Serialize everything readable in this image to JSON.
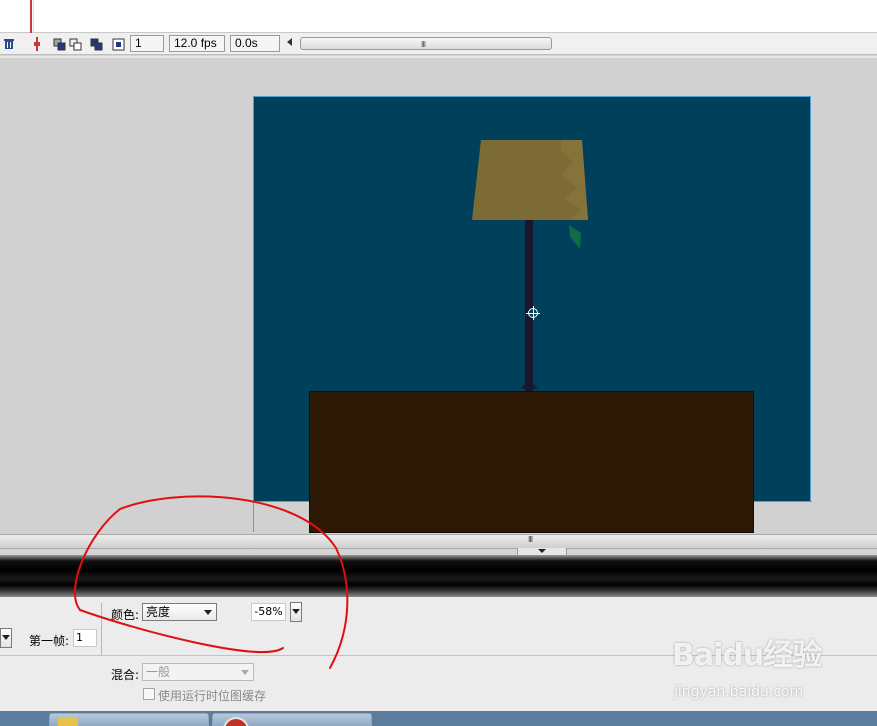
{
  "timeline": {
    "frame_number": "1",
    "fps": "12.0 fps",
    "elapsed": "0.0s",
    "scroll_grip": "III",
    "icons": [
      "trash-icon",
      "onion-skin-icon",
      "onion-outline-icon",
      "edit-multiple-frames-icon",
      "modify-onion-markers-icon"
    ]
  },
  "splitter": {
    "grip": "III"
  },
  "properties": {
    "color_label": "颜色:",
    "color_mode": "亮度",
    "brightness_value": "-58%",
    "first_frame_label": "第一帧:",
    "first_frame_value": "1",
    "blend_label": "混合:",
    "blend_mode": "一般",
    "cache_label": "使用运行时位图缓存"
  },
  "colors": {
    "stage_background": "#00405a",
    "table": "#2e1806",
    "lamp_shade": "#7d6b35",
    "annotation": "#e01010"
  },
  "watermark": {
    "logo": "Baidu经验",
    "url": "jingyan.baidu.com"
  }
}
